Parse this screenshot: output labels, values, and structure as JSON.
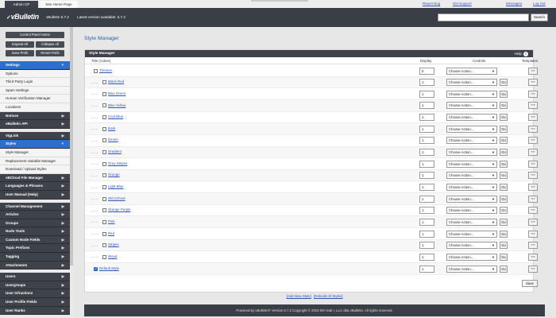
{
  "tabs": {
    "admin_cp": "Admin CP",
    "site_home": "Site Home Page"
  },
  "top_links": [
    "Report Bug",
    "Get Support",
    "Messages",
    "Log Out"
  ],
  "header": {
    "logo_text": "vBulletin",
    "version": "vBulletin 5.7.2",
    "latest": "Latest version available: 5.7.2",
    "search_placeholder": "",
    "search_button": "Search"
  },
  "sidebar": {
    "tools": {
      "control_panel_home": "Control Panel Home",
      "expand_all": "Expand All",
      "collapse_all": "Collapse All",
      "save_prefs": "Save Prefs",
      "revert_prefs": "Revert Prefs"
    },
    "items": [
      {
        "label": "Settings",
        "type": "cat",
        "active": true
      },
      {
        "label": "Options",
        "type": "sub"
      },
      {
        "label": "Third Party Login",
        "type": "sub"
      },
      {
        "label": "Spam Settings",
        "type": "sub"
      },
      {
        "label": "Human Verification Manager",
        "type": "sub"
      },
      {
        "label": "Locations",
        "type": "sub"
      },
      {
        "label": "Notices",
        "type": "cat"
      },
      {
        "label": "vBulletin API",
        "type": "cat"
      },
      {
        "label": "",
        "type": "gap"
      },
      {
        "label": "VigLink",
        "type": "cat"
      },
      {
        "label": "Styles",
        "type": "cat",
        "active": true
      },
      {
        "label": "Style Manager",
        "type": "sub"
      },
      {
        "label": "Replacement Variable Manager",
        "type": "sub"
      },
      {
        "label": "Download / Upload Styles",
        "type": "sub"
      },
      {
        "label": "vBCloud File Manager",
        "type": "cat"
      },
      {
        "label": "Languages & Phrases",
        "type": "cat"
      },
      {
        "label": "User Manual (Help)",
        "type": "cat"
      },
      {
        "label": "",
        "type": "gap"
      },
      {
        "label": "Channel Management",
        "type": "cat"
      },
      {
        "label": "Articles",
        "type": "cat"
      },
      {
        "label": "Groups",
        "type": "cat"
      },
      {
        "label": "Node Tools",
        "type": "cat"
      },
      {
        "label": "Custom Node Fields",
        "type": "cat"
      },
      {
        "label": "Topic Prefixes",
        "type": "cat"
      },
      {
        "label": "Tagging",
        "type": "cat"
      },
      {
        "label": "Attachments",
        "type": "cat"
      },
      {
        "label": "",
        "type": "gap"
      },
      {
        "label": "Users",
        "type": "cat"
      },
      {
        "label": "Usergroups",
        "type": "cat"
      },
      {
        "label": "User Infractions",
        "type": "cat"
      },
      {
        "label": "User Profile Fields",
        "type": "cat"
      },
      {
        "label": "User Ranks",
        "type": "cat"
      }
    ]
  },
  "main": {
    "page_title": "Style Manager",
    "panel_title": "Style Manager",
    "help_label": "Help",
    "columns": {
      "title": "Title (Active)",
      "display": "Display",
      "controls": "Controls",
      "templates": "Templates"
    },
    "select_default": "Choose Action...",
    "go_label": "Go",
    "templates_label": "« »",
    "save_label": "Save",
    "styles": [
      {
        "title": "Themes",
        "indent": 0,
        "display": "0",
        "checked": false,
        "has_go": false
      },
      {
        "title": "Black Red",
        "indent": 1,
        "display": "1",
        "checked": false,
        "has_go": true
      },
      {
        "title": "Blue Green",
        "indent": 1,
        "display": "1",
        "checked": false,
        "has_go": true
      },
      {
        "title": "Blue Yellow",
        "indent": 1,
        "display": "1",
        "checked": false,
        "has_go": true
      },
      {
        "title": "Cool Blue",
        "indent": 1,
        "display": "1",
        "checked": false,
        "has_go": true
      },
      {
        "title": "Dark",
        "indent": 1,
        "display": "1",
        "checked": false,
        "has_go": true
      },
      {
        "title": "Denim",
        "indent": 1,
        "display": "1",
        "checked": false,
        "has_go": true
      },
      {
        "title": "Gradient",
        "indent": 1,
        "display": "1",
        "checked": false,
        "has_go": true
      },
      {
        "title": "Grey Stripes",
        "indent": 1,
        "display": "1",
        "checked": false,
        "has_go": true
      },
      {
        "title": "Grunge",
        "indent": 1,
        "display": "1",
        "checked": false,
        "has_go": true
      },
      {
        "title": "Light Blue",
        "indent": 1,
        "display": "1",
        "checked": false,
        "has_go": true
      },
      {
        "title": "Old School",
        "indent": 1,
        "display": "1",
        "checked": false,
        "has_go": true
      },
      {
        "title": "Orange Purple",
        "indent": 1,
        "display": "1",
        "checked": false,
        "has_go": true
      },
      {
        "title": "Pink",
        "indent": 1,
        "display": "1",
        "checked": false,
        "has_go": true
      },
      {
        "title": "Red",
        "indent": 1,
        "display": "1",
        "checked": false,
        "has_go": true
      },
      {
        "title": "Stripes",
        "indent": 1,
        "display": "1",
        "checked": false,
        "has_go": true
      },
      {
        "title": "Wood",
        "indent": 1,
        "display": "1",
        "checked": false,
        "has_go": true
      },
      {
        "title": "Default Style",
        "indent": 0,
        "display": "1",
        "checked": true,
        "has_go": true
      }
    ],
    "bottom_links": [
      "[Add New Style]",
      "[Rebuild All Styles]"
    ],
    "footer": "Powered by vBulletin® Version 5.7.2 Copyright © 2023 MH Sub I, LLC dba vBulletin. All rights reserved."
  },
  "colors": {
    "header": "#3a3e46",
    "active": "#2d6fcc",
    "link": "#2d56b8"
  }
}
